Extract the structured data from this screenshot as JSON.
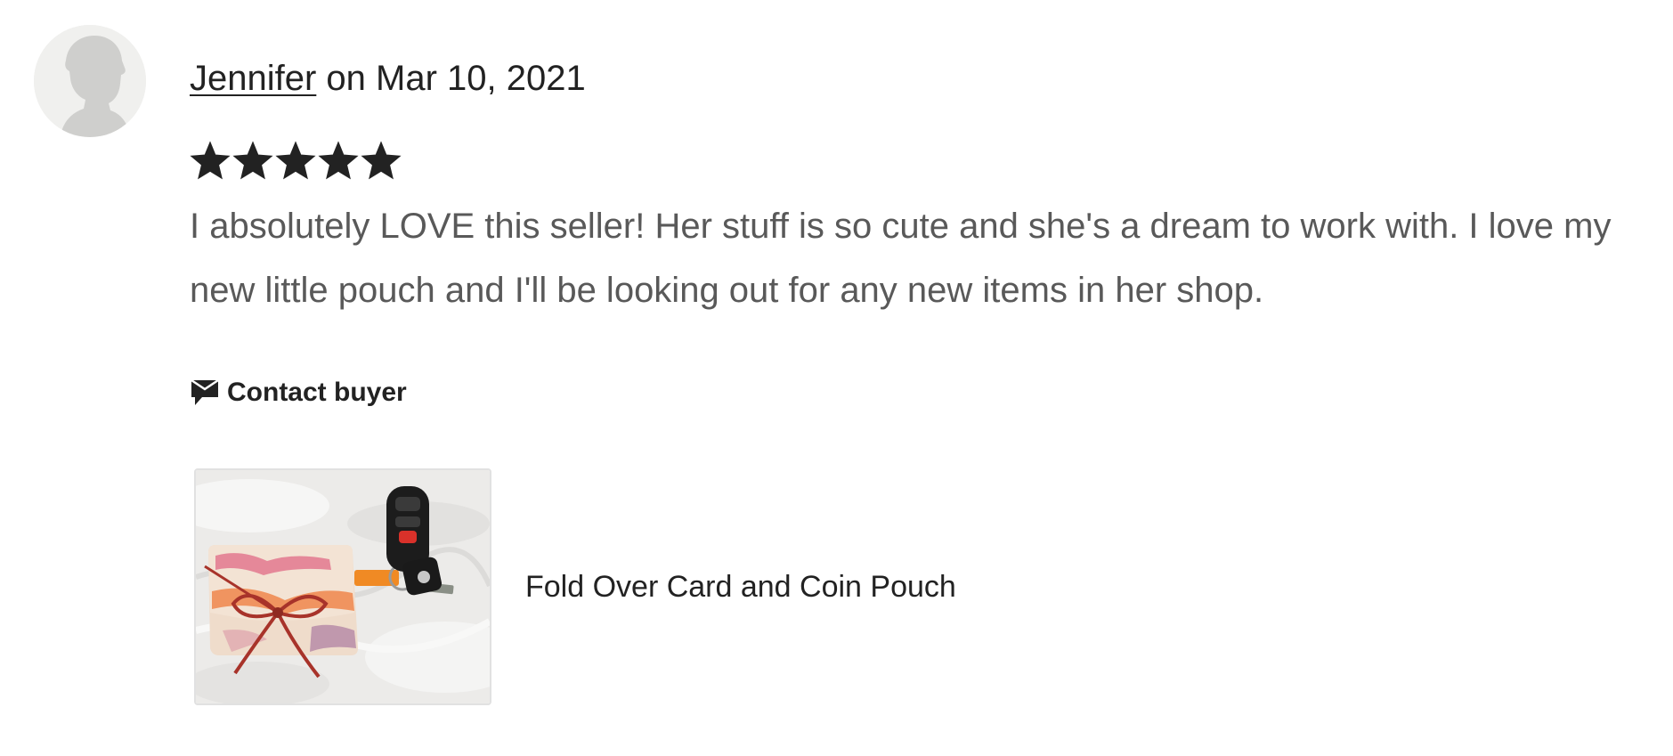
{
  "review": {
    "reviewer_name": "Jennifer",
    "date_text": " on Mar 10, 2021",
    "rating": 5,
    "rating_max": 5,
    "text": "I absolutely LOVE this seller! Her stuff is so cute and she's a dream to work with. I love my new little pouch and I'll be looking out for any new items in her shop."
  },
  "actions": {
    "contact_label": "Contact buyer",
    "contact_icon": "message-icon"
  },
  "listing": {
    "title": "Fold Over Card and Coin Pouch"
  },
  "colors": {
    "text_primary": "#222222",
    "text_secondary": "#595959",
    "star": "#222222",
    "avatar_bg": "#f0f0ee",
    "avatar_silhouette": "#cfcfcd"
  }
}
